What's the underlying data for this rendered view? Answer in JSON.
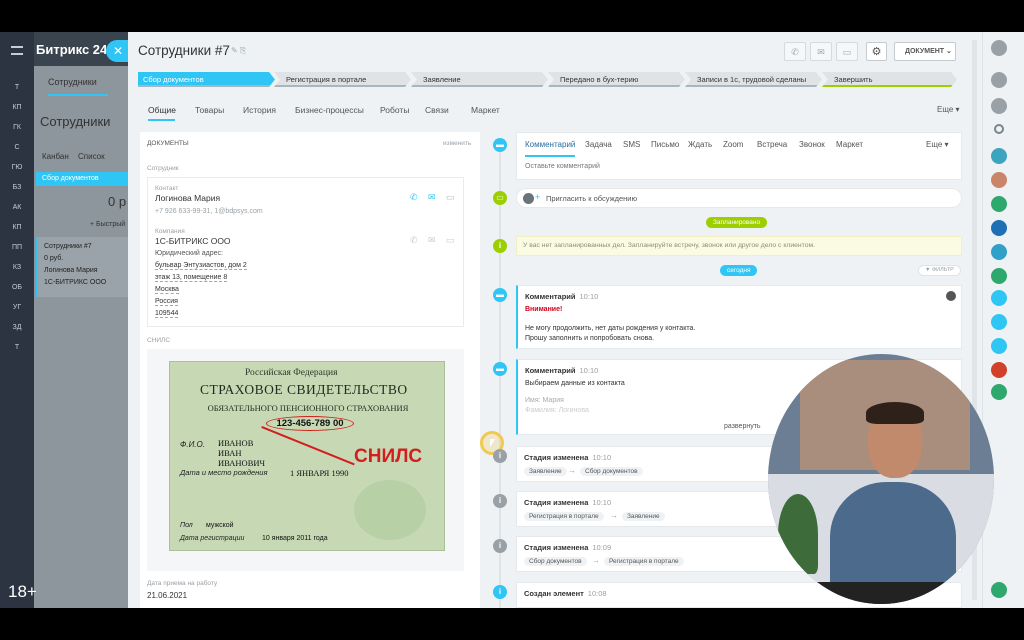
{
  "sidebar": {
    "logo": "Битрикс 24",
    "section": "Сотрудники",
    "items": [
      "Т",
      "КП",
      "ГК",
      "С",
      "ГЮ",
      "БЗ",
      "АК",
      "КП",
      "ПП",
      "КЗ",
      "ОБ",
      "УГ",
      "ЗД",
      "Т"
    ]
  },
  "background": {
    "page_title": "Сотрудники",
    "tabs": [
      "Канбан",
      "Список"
    ],
    "column": "Сбор документов",
    "column_sum": "0 р",
    "quick": "+ Быстрый",
    "card_title": "Сотрудники #7",
    "card_sum": "0 руб.",
    "card_contact": "Логинова Мария",
    "card_company": "1С-БИТРИКС ООО"
  },
  "header": {
    "title": "Сотрудники #7",
    "doc_button": "ДОКУМЕНТ"
  },
  "stages": [
    "Сбор документов",
    "Регистрация в портале",
    "Заявление",
    "Передано в бух-терию",
    "Записи в 1с, трудовой сделаны",
    "Завершить"
  ],
  "tabs": [
    "Общие",
    "Товары",
    "История",
    "Бизнес-процессы",
    "Роботы",
    "Связи",
    "Маркет"
  ],
  "tabs_more": "Еще",
  "docs": {
    "heading": "ДОКУМЕНТЫ",
    "edit": "изменить",
    "employee_label": "Сотрудник",
    "contact_label": "Контакт",
    "contact_name": "Логинова Мария",
    "contact_info": "+7 926 633-99-31, 1@bdpsys.com",
    "company_label": "Компания",
    "company_name": "1С-БИТРИКС ООО",
    "address_label": "Юридический адрес:",
    "address_lines": [
      "бульвар Энтузиастов, дом 2",
      "этаж 13, помещение 8",
      "Москва",
      "Россия",
      "109544"
    ],
    "snils_label": "СНИЛС",
    "hire_label": "Дата приема на работу",
    "hire_date": "21.06.2021"
  },
  "snils_card": {
    "country": "Российская Федерация",
    "title": "СТРАХОВОЕ СВИДЕТЕЛЬСТВО",
    "subtitle": "ОБЯЗАТЕЛЬНОГО ПЕНСИОННОГО СТРАХОВАНИЯ",
    "number": "123-456-789 00",
    "fio_label": "Ф.И.О.",
    "fio": [
      "ИВАНОВ",
      "ИВАН",
      "ИВАНОВИЧ"
    ],
    "birth_label": "Дата и место рождения",
    "birth": "1 ЯНВАРЯ 1990",
    "stamp": "СНИЛС",
    "sex_label": "Пол",
    "sex": "мужской",
    "reg_label": "Дата регистрации",
    "reg": "10 января 2011 года"
  },
  "activity": {
    "tabs": [
      "Комментарий",
      "Задача",
      "SMS",
      "Письмо",
      "Ждать",
      "Zoom",
      "Встреча",
      "Звонок",
      "Маркет"
    ],
    "more": "Еще",
    "placeholder": "Оставьте комментарий",
    "invite": "Пригласить к обсуждению",
    "planned": "Запланировано",
    "no_plans": "У вас нет запланированных дел. Запланируйте встречу, звонок или другое дело с клиентом.",
    "today": "сегодня",
    "filter": "ФИЛЬТР"
  },
  "timeline": [
    {
      "title": "Комментарий",
      "time": "10:10",
      "warn": "Внимание!",
      "lines": [
        "Не могу продолжить, нет даты рождения у контакта.",
        "Прошу заполнить и попробовать снова."
      ]
    },
    {
      "title": "Комментарий",
      "time": "10:10",
      "lines": [
        "Выбираем данные из контакта",
        "Имя: Мария",
        "Фамилия: Логинова"
      ],
      "expand": "развернуть"
    },
    {
      "title": "Стадия изменена",
      "time": "10:10",
      "from": "Заявление",
      "to": "Сбор документов"
    },
    {
      "title": "Стадия изменена",
      "time": "10:10",
      "from": "Регистрация в портале",
      "to": "Заявление"
    },
    {
      "title": "Стадия изменена",
      "time": "10:09",
      "from": "Сбор документов",
      "to": "Регистрация в портале"
    },
    {
      "title": "Создан элемент",
      "time": "10:08"
    }
  ],
  "overlay": {
    "age": "18+"
  },
  "colors": {
    "accent": "#2fc6f6",
    "stage_active": "#2fc6f6",
    "green": "#9dcf00"
  }
}
